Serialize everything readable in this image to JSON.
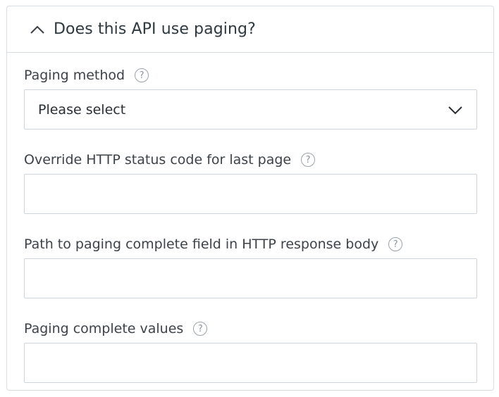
{
  "section": {
    "title": "Does this API use paging?",
    "toggle_icon": "chevron-up-icon"
  },
  "fields": {
    "paging_method": {
      "label": "Paging method",
      "selected": "Please select",
      "help_icon": "help-icon",
      "dropdown_icon": "chevron-down-icon"
    },
    "override_status": {
      "label": "Override HTTP status code for last page",
      "value": "",
      "help_icon": "help-icon"
    },
    "complete_path": {
      "label": "Path to paging complete field in HTTP response body",
      "value": "",
      "help_icon": "help-icon"
    },
    "complete_values": {
      "label": "Paging complete values",
      "value": "",
      "help_icon": "help-icon"
    }
  },
  "help_glyph": "?"
}
